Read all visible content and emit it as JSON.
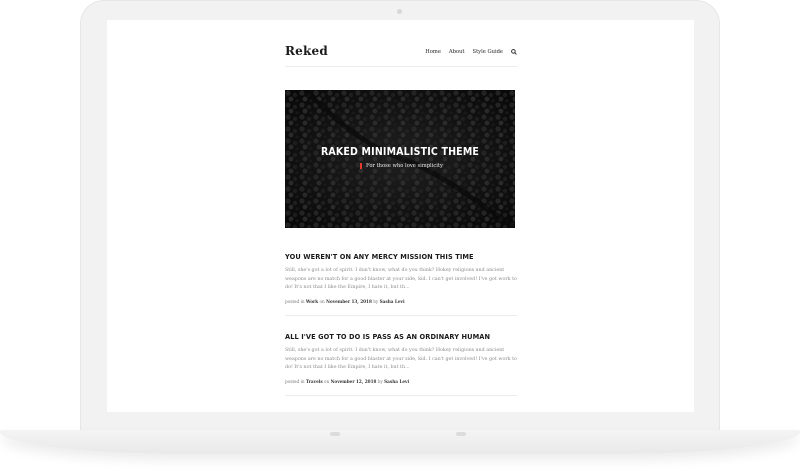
{
  "site": {
    "logo": "Reked",
    "nav": [
      {
        "label": "Home"
      },
      {
        "label": "About"
      },
      {
        "label": "Style Guide"
      }
    ],
    "search_icon": "search-icon"
  },
  "hero": {
    "title": "RAKED MINIMALISTIC THEME",
    "subtitle": "For those who love simplicity",
    "accent_color": "#e23d2f"
  },
  "posts": [
    {
      "title": "YOU WEREN'T ON ANY MERCY MISSION THIS TIME",
      "excerpt": "Still, she's got a lot of spirit. I don't know, what do you think? Hokey religions and ancient weapons are no match for a good blaster at your side, kid. I can't get involved! I've got work to do! It's not that I like the Empire, I hate it, but th...",
      "meta_prefix": "posted in",
      "category": "Work",
      "meta_on": "on",
      "date": "November 13, 2018",
      "meta_by": "by",
      "author": "Sasha Levi"
    },
    {
      "title": "ALL I'VE GOT TO DO IS PASS AS AN ORDINARY HUMAN",
      "excerpt": "Still, she's got a lot of spirit. I don't know, what do you think? Hokey religions and ancient weapons are no match for a good blaster at your side, kid. I can't get involved! I've got work to do! It's not that I like the Empire, I hate it, but th...",
      "meta_prefix": "posted in",
      "category": "Travels",
      "meta_on": "on",
      "date": "November 12, 2018",
      "meta_by": "by",
      "author": "Sasha Levi"
    }
  ]
}
